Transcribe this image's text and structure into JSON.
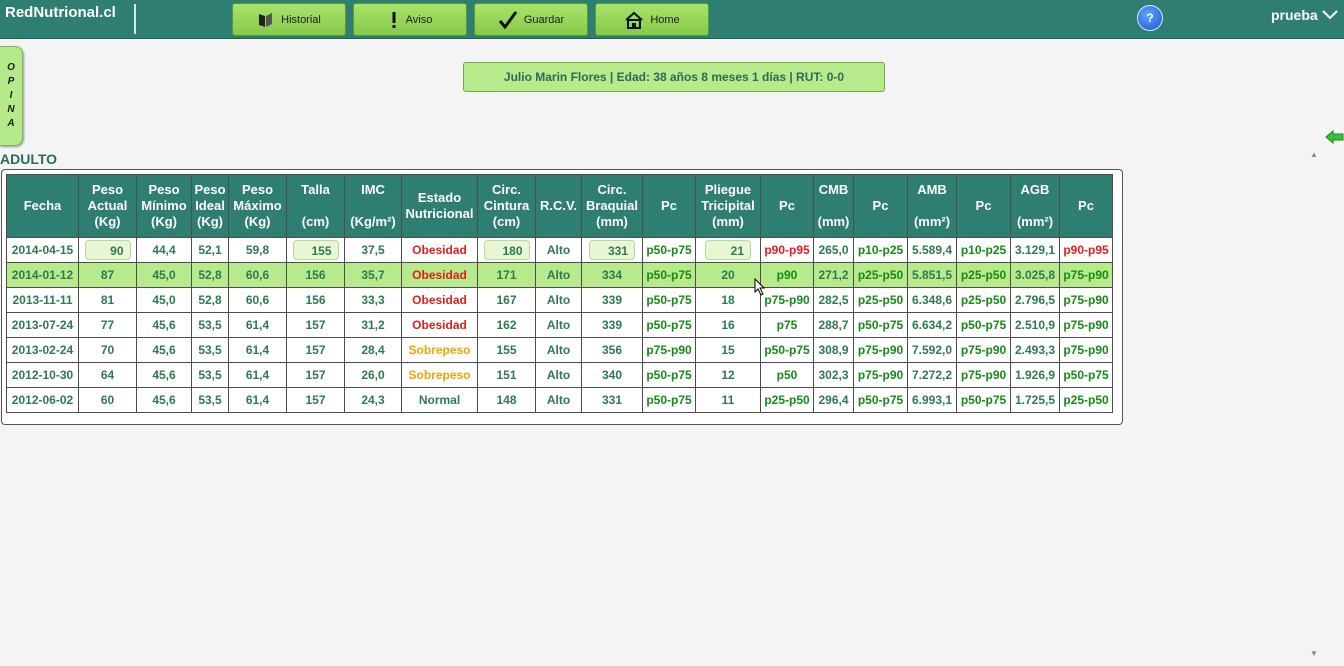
{
  "app": {
    "brand": "RedNutrional.cl",
    "nav": [
      {
        "id": "historial",
        "label": "Historial"
      },
      {
        "id": "aviso",
        "label": "Aviso"
      },
      {
        "id": "guardar",
        "label": "Guardar"
      },
      {
        "id": "home",
        "label": "Home"
      }
    ],
    "help": "?",
    "user": "prueba"
  },
  "feedback_tab": [
    "O",
    "P",
    "I",
    "N",
    "A"
  ],
  "patient": "Julio Marin Flores | Edad: 38 años 8 meses 1 días | RUT: 0-0",
  "section_title": "ADULTO",
  "colors": {
    "accent": "#2e7e72",
    "highlight": "#b6ea8a",
    "obesidad": "#dd1f1f",
    "sobrepeso": "#f0a400"
  },
  "headers": [
    [
      "Fecha"
    ],
    [
      "Peso",
      "Actual",
      "(Kg)"
    ],
    [
      "Peso",
      "Mínimo",
      "(Kg)"
    ],
    [
      "Peso",
      "Ideal",
      "(Kg)"
    ],
    [
      "Peso",
      "Máximo",
      "(Kg)"
    ],
    [
      "Talla",
      "",
      "(cm)"
    ],
    [
      "IMC",
      "",
      "(Kg/m²)"
    ],
    [
      "Estado",
      "Nutricional"
    ],
    [
      "Circ.",
      "Cintura",
      "(cm)"
    ],
    [
      "R.C.V."
    ],
    [
      "Circ.",
      "Braquial",
      "(mm)"
    ],
    [
      "Pc"
    ],
    [
      "Pliegue",
      "Tricipital",
      "(mm)"
    ],
    [
      "Pc"
    ],
    [
      "CMB",
      "",
      "(mm)"
    ],
    [
      "Pc"
    ],
    [
      "AMB",
      "",
      "(mm²)"
    ],
    [
      "Pc"
    ],
    [
      "AGB",
      "",
      "(mm²)"
    ],
    [
      "Pc"
    ]
  ],
  "rows": [
    [
      "2014-04-15",
      "90",
      "44,4",
      "52,1",
      "59,8",
      "155",
      "37,5",
      "Obesidad",
      "180",
      "Alto",
      "331",
      "p50-p75",
      "21",
      "p90-p95",
      "265,0",
      "p10-p25",
      "5.589,4",
      "p10-p25",
      "3.129,1",
      "p90-p95"
    ],
    [
      "2014-01-12",
      "87",
      "45,0",
      "52,8",
      "60,6",
      "156",
      "35,7",
      "Obesidad",
      "171",
      "Alto",
      "334",
      "p50-p75",
      "20",
      "p90",
      "271,2",
      "p25-p50",
      "5.851,5",
      "p25-p50",
      "3.025,8",
      "p75-p90"
    ],
    [
      "2013-11-11",
      "81",
      "45,0",
      "52,8",
      "60,6",
      "156",
      "33,3",
      "Obesidad",
      "167",
      "Alto",
      "339",
      "p50-p75",
      "18",
      "p75-p90",
      "282,5",
      "p25-p50",
      "6.348,6",
      "p25-p50",
      "2.796,5",
      "p75-p90"
    ],
    [
      "2013-07-24",
      "77",
      "45,6",
      "53,5",
      "61,4",
      "157",
      "31,2",
      "Obesidad",
      "162",
      "Alto",
      "339",
      "p50-p75",
      "16",
      "p75",
      "288,7",
      "p50-p75",
      "6.634,2",
      "p50-p75",
      "2.510,9",
      "p75-p90"
    ],
    [
      "2013-02-24",
      "70",
      "45,6",
      "53,5",
      "61,4",
      "157",
      "28,4",
      "Sobrepeso",
      "155",
      "Alto",
      "356",
      "p75-p90",
      "15",
      "p50-p75",
      "308,9",
      "p75-p90",
      "7.592,0",
      "p75-p90",
      "2.493,3",
      "p75-p90"
    ],
    [
      "2012-10-30",
      "64",
      "45,6",
      "53,5",
      "61,4",
      "157",
      "26,0",
      "Sobrepeso",
      "151",
      "Alto",
      "340",
      "p50-p75",
      "12",
      "p50",
      "302,3",
      "p75-p90",
      "7.272,2",
      "p75-p90",
      "1.926,9",
      "p50-p75"
    ],
    [
      "2012-06-02",
      "60",
      "45,6",
      "53,5",
      "61,4",
      "157",
      "24,3",
      "Normal",
      "148",
      "Alto",
      "331",
      "p50-p75",
      "11",
      "p25-p50",
      "296,4",
      "p50-p75",
      "6.993,1",
      "p50-p75",
      "1.725,5",
      "p25-p50"
    ]
  ]
}
